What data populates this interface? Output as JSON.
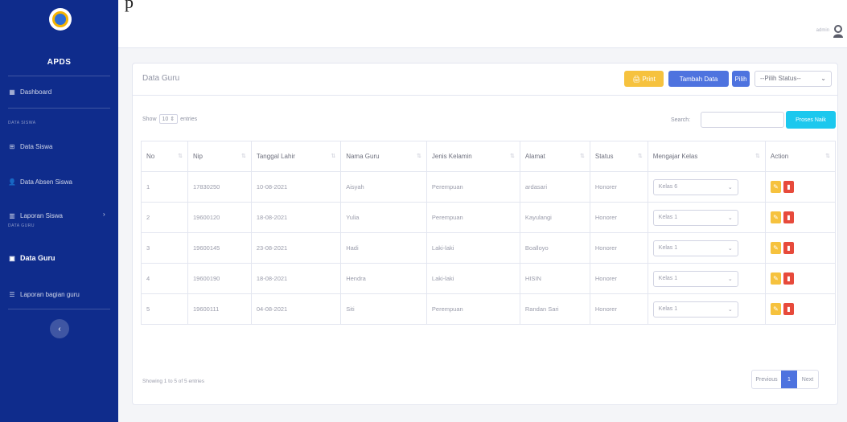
{
  "caption": "p",
  "sidebar": {
    "brand": "APDS",
    "dashboard": "Dashboard",
    "heading1": "DATA SISWA",
    "data_siswa": "Data Siswa",
    "data_absen": "Data Absen Siswa",
    "laporan_siswa": "Laporan Siswa",
    "heading2": "DATA GURU",
    "data_guru": "Data Guru",
    "laporan_guru": "Laporan bagian guru"
  },
  "topbar": {
    "user": "admin"
  },
  "page": {
    "title": "Data Guru",
    "print_label": "Print",
    "add_label": "Tambah Data",
    "pilih_label": "Pilih",
    "status_select": "--Pilih Status--",
    "show_label": "Show",
    "entries_value": "10",
    "entries_label": "entries",
    "search_label": "Search:",
    "naik_label": "Proses Naik"
  },
  "table": {
    "headers": [
      "No",
      "Nip",
      "Tanggal Lahir",
      "Nama Guru",
      "Jenis Kelamin",
      "Alamat",
      "Status",
      "Mengajar Kelas",
      "Action"
    ],
    "rows": [
      [
        "1",
        "17830250",
        "10-08-2021",
        "Aisyah",
        "Perempuan",
        "ardasari",
        "Honorer",
        "Kelas 6"
      ],
      [
        "2",
        "19600120",
        "18-08-2021",
        "Yulia",
        "Perempuan",
        "Kayulangi",
        "Honorer",
        "Kelas 1"
      ],
      [
        "3",
        "19600145",
        "23-08-2021",
        "Hadi",
        "Laki-laki",
        "Boalloyo",
        "Honorer",
        "Kelas 1"
      ],
      [
        "4",
        "19600190",
        "18-08-2021",
        "Hendra",
        "Laki-laki",
        "HISIN",
        "Honorer",
        "Kelas 1"
      ],
      [
        "5",
        "19600111",
        "04-08-2021",
        "Siti",
        "Perempuan",
        "Randan Sari",
        "Honorer",
        "Kelas 1"
      ]
    ]
  },
  "footer": {
    "showing": "Showing 1 to 5 of 5 entries",
    "prev": "Previous",
    "page": "1",
    "next": "Next"
  }
}
